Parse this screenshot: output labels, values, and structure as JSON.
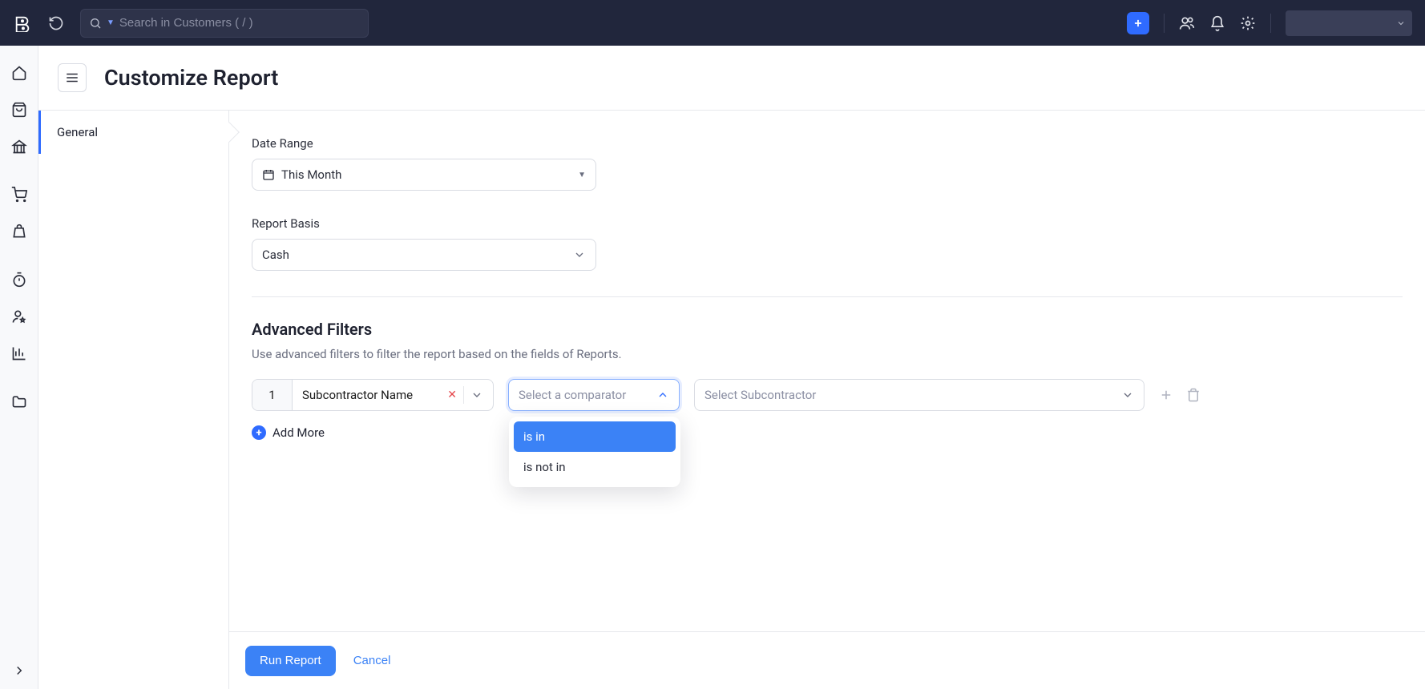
{
  "header": {
    "search_placeholder": "Search in Customers ( / )"
  },
  "page": {
    "title": "Customize Report"
  },
  "sideTabs": [
    {
      "label": "General"
    }
  ],
  "form": {
    "dateRange": {
      "label": "Date Range",
      "value": "This Month"
    },
    "reportBasis": {
      "label": "Report Basis",
      "value": "Cash"
    },
    "advanced": {
      "title": "Advanced Filters",
      "hint": "Use advanced filters to filter the report based on the fields of Reports.",
      "rows": [
        {
          "index": "1",
          "field": "Subcontractor Name",
          "comparator_placeholder": "Select a comparator",
          "value_placeholder": "Select Subcontractor"
        }
      ],
      "comparator_options": [
        {
          "label": "is in",
          "highlight": true
        },
        {
          "label": "is not in",
          "highlight": false
        }
      ],
      "add_more": "Add More"
    }
  },
  "footer": {
    "run": "Run Report",
    "cancel": "Cancel"
  }
}
